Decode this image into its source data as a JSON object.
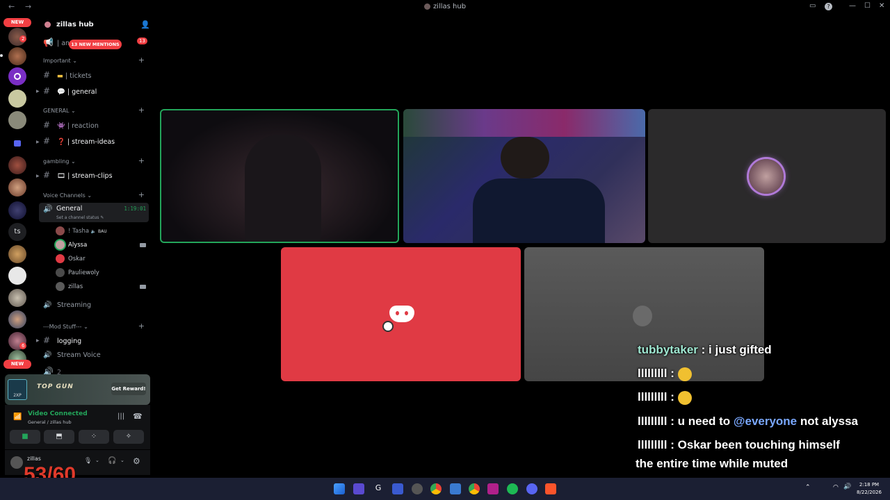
{
  "window": {
    "title": "zillas hub"
  },
  "serverbar": {
    "new_label_top": "NEW",
    "new_label_bottom": "NEW",
    "text_server": "ts",
    "badge_1": "2",
    "badge_2": "6"
  },
  "channels": {
    "server_name": "zillas hub",
    "mentions_pill": "13 NEW MENTIONS",
    "mentions_count": "13",
    "first_channel": "| announcements",
    "categories": {
      "important": "Important",
      "general": "GENERAL",
      "gambling": "gambling",
      "voice": "Voice Channels",
      "mod": "---Mod Stuff---"
    },
    "items": {
      "tickets": "| tickets",
      "general_text": "| general",
      "reaction": "| reaction",
      "stream_ideas": "| stream-ideas",
      "stream_clips": "| stream-clips",
      "voice_general": "General",
      "voice_timer": "1:19:01",
      "channel_status": "Set a channel status",
      "streaming": "Streaming",
      "logging": "logging",
      "stream_voice": "Stream Voice",
      "cut_off": "2"
    },
    "voice_users": {
      "tasha": "! Tasha",
      "tasha_tag": "BAU",
      "alyssa": "Alyssa",
      "oskar": "Oskar",
      "pauliewoly": "Pauliewoly",
      "zillas": "zillas"
    }
  },
  "promo": {
    "badge": "2XP",
    "title": "TOP GUN",
    "button": "Get Reward!"
  },
  "voice_panel": {
    "status": "Video Connected",
    "location": "General / zillas hub"
  },
  "user_panel": {
    "username": "zillas"
  },
  "overlay": {
    "fps": "53/60"
  },
  "chat": {
    "line1_user": "tubbytaker",
    "line1_text": " : i just gifted",
    "line2_user": "lllllllll",
    "line2_text": " : ",
    "line3_user": "lllllllll",
    "line3_text": " : ",
    "line4_user": "lllllllll",
    "line4_text": " : u need to ",
    "line4_mention": "@everyone",
    "line4_text_end": " not alyssa",
    "line5_user": "lllllllll",
    "line5_text": " : Oskar been touching himself",
    "line6_text": "the entire time while muted"
  },
  "taskbar": {
    "time": "2:18 PM",
    "date": "8/22/2026"
  },
  "colors": {
    "discord_red": "#e03a44",
    "voice_green": "#23a55a",
    "chat_user_teal": "#9ee6d0",
    "mention_blue": "#7aa8ff"
  }
}
